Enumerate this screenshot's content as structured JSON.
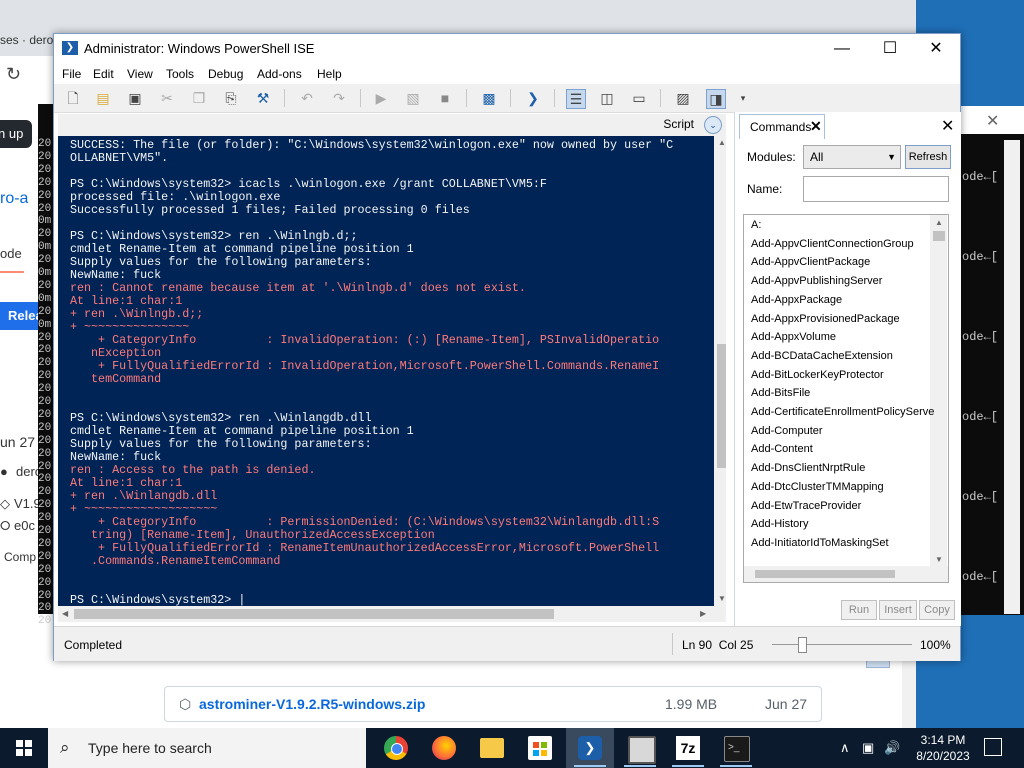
{
  "browser": {
    "tab_partial": "ses · dero",
    "signup_partial": "n up",
    "ro_partial": "ro-a",
    "ode_partial": "ode",
    "release_button_partial": "Relea",
    "date_partial": "un 27",
    "user_partial": "dero",
    "version_partial": "V1.9",
    "commit_partial": "e0c",
    "compare_partial": "Comp",
    "release_asset": {
      "name": "astrominer-V1.9.2.R5-windows.zip",
      "size": "1.99 MB",
      "date": "Jun 27"
    },
    "left_terminal_lines": [
      "20",
      "20",
      "20",
      "20",
      "20",
      "20",
      "0m",
      "20",
      "0m",
      "20",
      "0m",
      "20",
      "0m",
      "20",
      "0m",
      "20",
      "20",
      "20",
      "20",
      "20",
      "20",
      "20",
      "20",
      "20",
      "20",
      "20",
      "20",
      "20",
      "20",
      "20",
      "20",
      "20",
      "20",
      "20",
      "20",
      "20",
      "20",
      "20"
    ]
  },
  "right_terminal": {
    "lines": [
      "ode←[",
      "ode←[",
      "ode←[",
      "ode←[",
      "ode←[",
      "ode←[",
      "ode←["
    ]
  },
  "ise": {
    "title": "Administrator: Windows PowerShell ISE",
    "menu": [
      "File",
      "Edit",
      "View",
      "Tools",
      "Debug",
      "Add-ons",
      "Help"
    ],
    "script_label": "Script",
    "console_lines": [
      {
        "t": "SUCCESS: The file (or folder): \"C:\\Windows\\system32\\winlogon.exe\" now owned by user \"C",
        "c": "w"
      },
      {
        "t": "OLLABNET\\VM5\".",
        "c": "w"
      },
      {
        "t": "",
        "c": "w"
      },
      {
        "t": "PS C:\\Windows\\system32> icacls .\\winlogon.exe /grant COLLABNET\\VM5:F",
        "c": "w"
      },
      {
        "t": "processed file: .\\winlogon.exe",
        "c": "w"
      },
      {
        "t": "Successfully processed 1 files; Failed processing 0 files",
        "c": "w"
      },
      {
        "t": "",
        "c": "w"
      },
      {
        "t": "PS C:\\Windows\\system32> ren .\\Winlngb.d;;",
        "c": "w"
      },
      {
        "t": "cmdlet Rename-Item at command pipeline position 1",
        "c": "w"
      },
      {
        "t": "Supply values for the following parameters:",
        "c": "w"
      },
      {
        "t": "NewName: fuck",
        "c": "w"
      },
      {
        "t": "ren : Cannot rename because item at '.\\Winlngb.d' does not exist.",
        "c": "r"
      },
      {
        "t": "At line:1 char:1",
        "c": "r"
      },
      {
        "t": "+ ren .\\Winlngb.d;;",
        "c": "r"
      },
      {
        "t": "+ ~~~~~~~~~~~~~~~",
        "c": "r"
      },
      {
        "t": "    + CategoryInfo          : InvalidOperation: (:) [Rename-Item], PSInvalidOperatio",
        "c": "r"
      },
      {
        "t": "   nException",
        "c": "r"
      },
      {
        "t": "    + FullyQualifiedErrorId : InvalidOperation,Microsoft.PowerShell.Commands.RenameI",
        "c": "r"
      },
      {
        "t": "   temCommand",
        "c": "r"
      },
      {
        "t": "",
        "c": "w"
      },
      {
        "t": "",
        "c": "w"
      },
      {
        "t": "PS C:\\Windows\\system32> ren .\\Winlangdb.dll",
        "c": "w"
      },
      {
        "t": "cmdlet Rename-Item at command pipeline position 1",
        "c": "w"
      },
      {
        "t": "Supply values for the following parameters:",
        "c": "w"
      },
      {
        "t": "NewName: fuck",
        "c": "w"
      },
      {
        "t": "ren : Access to the path is denied.",
        "c": "r"
      },
      {
        "t": "At line:1 char:1",
        "c": "r"
      },
      {
        "t": "+ ren .\\Winlangdb.dll",
        "c": "r"
      },
      {
        "t": "+ ~~~~~~~~~~~~~~~~~~~",
        "c": "r"
      },
      {
        "t": "    + CategoryInfo          : PermissionDenied: (C:\\Windows\\system32\\Winlangdb.dll:S",
        "c": "r"
      },
      {
        "t": "   tring) [Rename-Item], UnauthorizedAccessException",
        "c": "r"
      },
      {
        "t": "    + FullyQualifiedErrorId : RenameItemUnauthorizedAccessError,Microsoft.PowerShell",
        "c": "r"
      },
      {
        "t": "   .Commands.RenameItemCommand",
        "c": "r"
      },
      {
        "t": "",
        "c": "w"
      },
      {
        "t": "",
        "c": "w"
      },
      {
        "t": "PS C:\\Windows\\system32> |",
        "c": "w"
      }
    ],
    "commands_pane": {
      "tab_label": "Commands",
      "modules_label": "Modules:",
      "modules_value": "All",
      "refresh_label": "Refresh",
      "name_label": "Name:",
      "name_value": "",
      "items": [
        "A:",
        "Add-AppvClientConnectionGroup",
        "Add-AppvClientPackage",
        "Add-AppvPublishingServer",
        "Add-AppxPackage",
        "Add-AppxProvisionedPackage",
        "Add-AppxVolume",
        "Add-BCDataCacheExtension",
        "Add-BitLockerKeyProtector",
        "Add-BitsFile",
        "Add-CertificateEnrollmentPolicyServe",
        "Add-Computer",
        "Add-Content",
        "Add-DnsClientNrptRule",
        "Add-DtcClusterTMMapping",
        "Add-EtwTraceProvider",
        "Add-History",
        "Add-InitiatorIdToMaskingSet"
      ],
      "run_label": "Run",
      "insert_label": "Insert",
      "copy_label": "Copy"
    },
    "status": {
      "text": "Completed",
      "position": "Ln 90  Col 25",
      "zoom": "100%"
    }
  },
  "taskbar": {
    "search_placeholder": "Type here to search",
    "time": "3:14 PM",
    "date": "8/20/2023",
    "apps": [
      "chrome-icon",
      "firefox-icon",
      "file-explorer-icon",
      "store-icon",
      "powershell-ise-icon",
      "vm-icon",
      "7zip-icon",
      "terminal-icon"
    ]
  }
}
